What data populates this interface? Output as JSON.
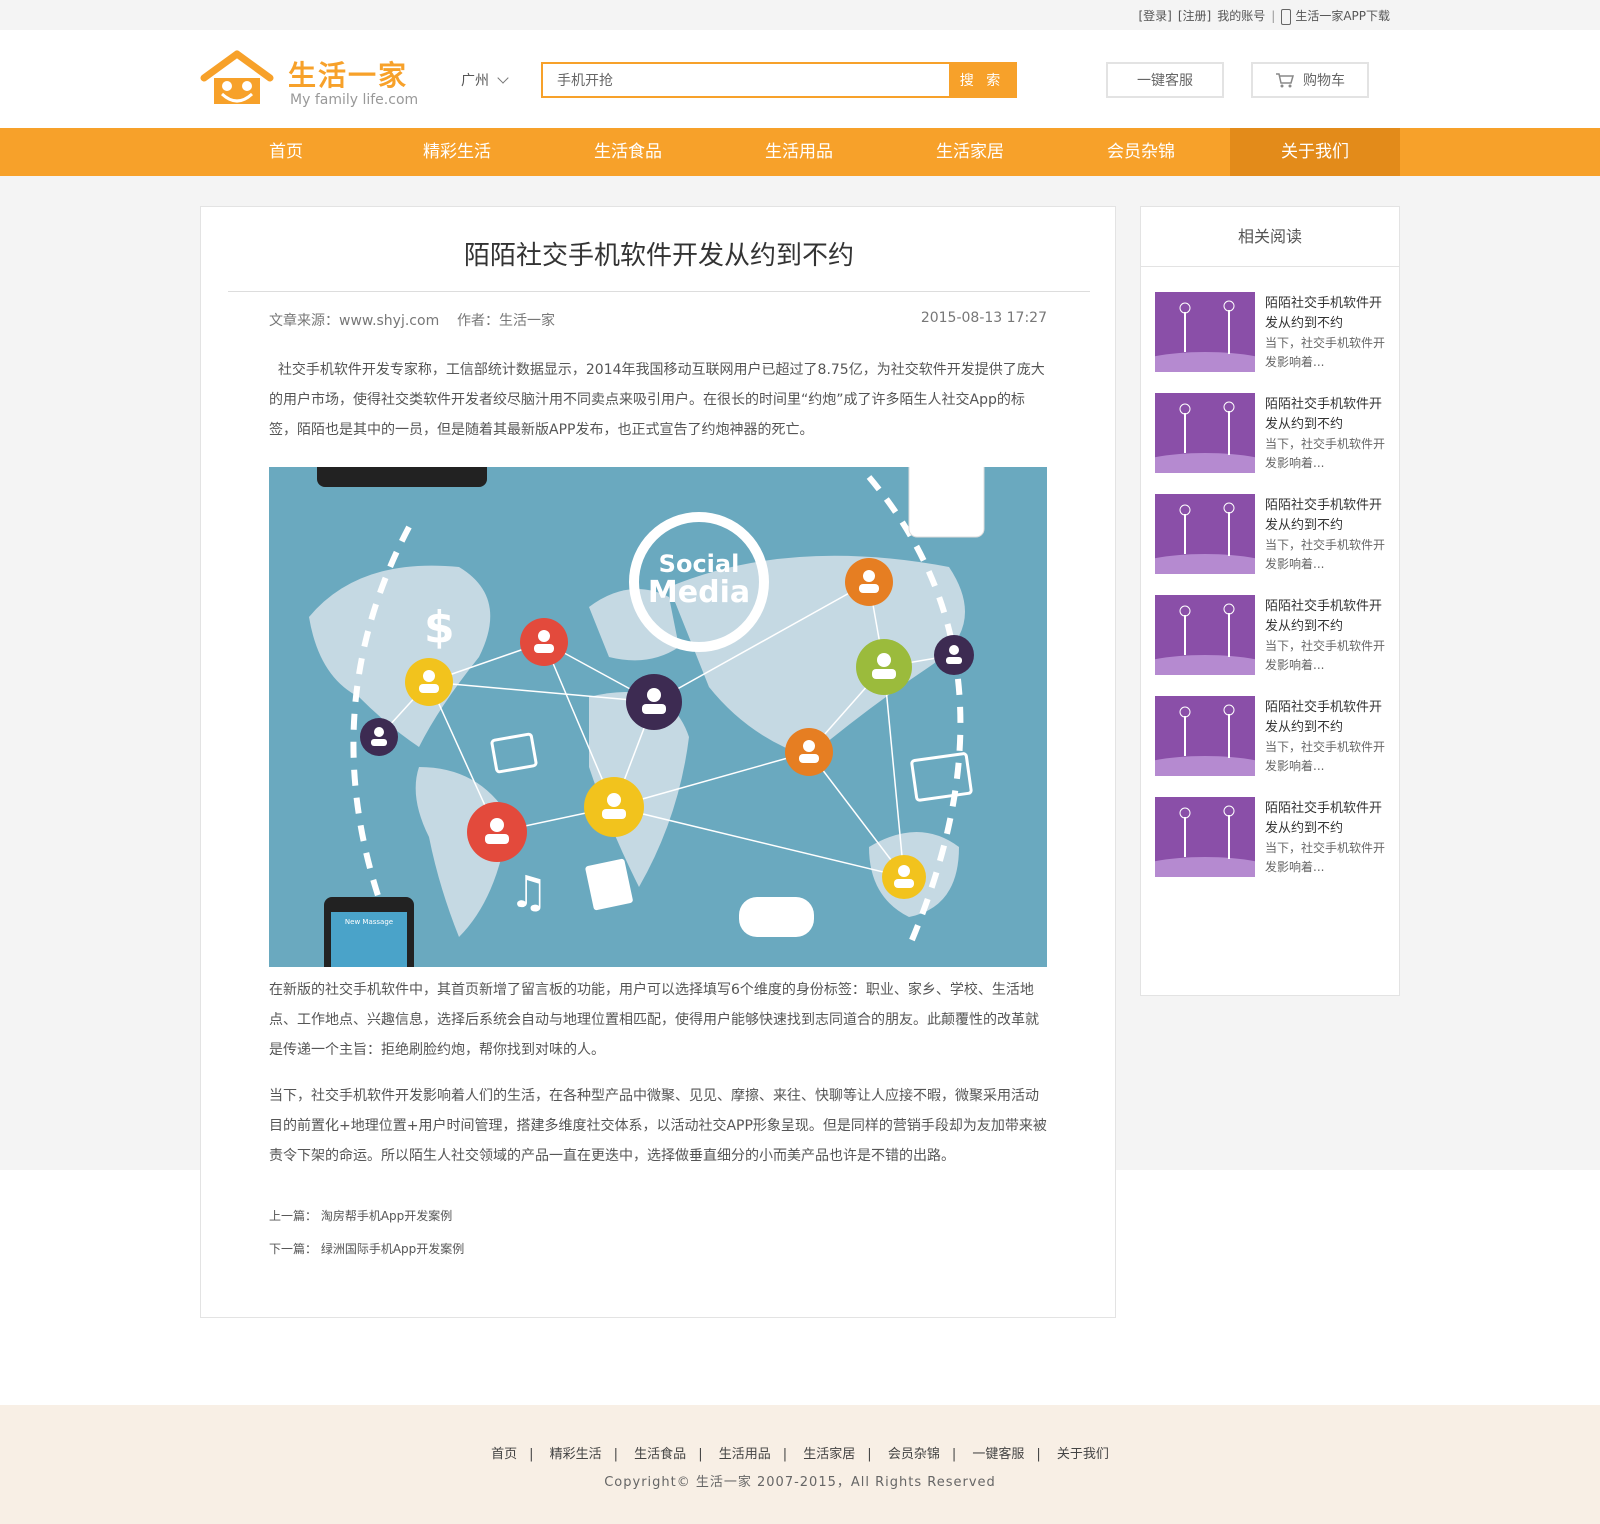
{
  "topbar": {
    "login": "[登录]",
    "register": "[注册]",
    "account": "我的账号",
    "sep": "|",
    "app": "生活一家APP下载"
  },
  "logo": {
    "brand": "生活一家",
    "slogan": "My family life.com"
  },
  "header": {
    "city": "广州",
    "search_value": "手机开抢",
    "search_button": "搜 索",
    "service": "一键客服",
    "cart": "购物车"
  },
  "nav": [
    "首页",
    "精彩生活",
    "生活食品",
    "生活用品",
    "生活家居",
    "会员杂锦",
    "关于我们"
  ],
  "article": {
    "title": "陌陌社交手机软件开发从约到不约",
    "meta": "文章来源：www.shyj.com    作者：生活一家",
    "date": "2015-08-13 17:27",
    "p1": "  社交手机软件开发专家称，工信部统计数据显示，2014年我国移动互联网用户已超过了8.75亿，为社交软件开发提供了庞大的用户市场，使得社交类软件开发者绞尽脑汁用不同卖点来吸引用户。在很长的时间里“约炮”成了许多陌生人社交App的标签，陌陌也是其中的一员，但是随着其最新版APP发布，也正式宣告了约炮神器的死亡。",
    "image_text": "Social Media",
    "phone_text": "New Massage",
    "p2": "在新版的社交手机软件中，其首页新增了留言板的功能，用户可以选择填写6个维度的身份标签：职业、家乡、学校、生活地点、工作地点、兴趣信息，选择后系统会自动与地理位置相匹配，使得用户能够快速找到志同道合的朋友。此颠覆性的改革就是传递一个主旨：拒绝刷脸约炮，帮你找到对味的人。",
    "p3": "当下，社交手机软件开发影响着人们的生活，在各种型产品中微聚、见见、摩擦、来往、快聊等让人应接不暇，微聚采用活动目的前置化+地理位置+用户时间管理，搭建多维度社交体系，以活动社交APP形象呈现。但是同样的营销手段却为友加带来被责令下架的命运。所以陌生人社交领域的产品一直在更迭中，选择做垂直细分的小而美产品也许是不错的出路。",
    "prev": "上一篇： 淘房帮手机App开发案例",
    "next": "下一篇： 绿洲国际手机App开发案例"
  },
  "sidebar": {
    "title": "相关阅读",
    "items": [
      {
        "title": "陌陌社交手机软件开发从约到不约",
        "desc": "当下，社交手机软件开发影响着..."
      },
      {
        "title": "陌陌社交手机软件开发从约到不约",
        "desc": "当下，社交手机软件开发影响着..."
      },
      {
        "title": "陌陌社交手机软件开发从约到不约",
        "desc": "当下，社交手机软件开发影响着..."
      },
      {
        "title": "陌陌社交手机软件开发从约到不约",
        "desc": "当下，社交手机软件开发影响着..."
      },
      {
        "title": "陌陌社交手机软件开发从约到不约",
        "desc": "当下，社交手机软件开发影响着..."
      },
      {
        "title": "陌陌社交手机软件开发从约到不约",
        "desc": "当下，社交手机软件开发影响着..."
      }
    ]
  },
  "footer": {
    "links": [
      "首页",
      "精彩生活",
      "生活食品",
      "生活用品",
      "生活家居",
      "会员杂锦",
      "一键客服",
      "关于我们"
    ],
    "sep": "|",
    "copyright": "Copyright© 生活一家 2007-2015，All Rights Reserved"
  },
  "colors": {
    "accent": "#f7a12a",
    "nav_active": "#e38b1a",
    "footer_bg": "#f8efe5",
    "thumb": "#8a4fa8",
    "map_bg": "#6aa9bf"
  }
}
